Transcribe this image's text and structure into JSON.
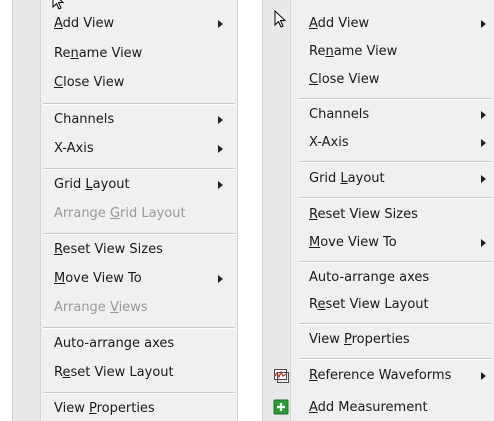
{
  "left_menu": {
    "items": [
      {
        "pre": "",
        "acc": "A",
        "post": "dd View",
        "submenu": true,
        "disabled": false
      },
      {
        "pre": "Re",
        "acc": "n",
        "post": "ame View",
        "submenu": false,
        "disabled": false
      },
      {
        "pre": "",
        "acc": "C",
        "post": "lose View",
        "submenu": false,
        "disabled": false
      },
      {
        "pre": "Channels",
        "acc": "",
        "post": "",
        "submenu": true,
        "disabled": false
      },
      {
        "pre": "X-Axis",
        "acc": "",
        "post": "",
        "submenu": true,
        "disabled": false
      },
      {
        "pre": "Grid ",
        "acc": "L",
        "post": "ayout",
        "submenu": true,
        "disabled": false
      },
      {
        "pre": "Arrange ",
        "acc": "G",
        "post": "rid Layout",
        "submenu": false,
        "disabled": true
      },
      {
        "pre": "",
        "acc": "R",
        "post": "eset View Sizes",
        "submenu": false,
        "disabled": false
      },
      {
        "pre": "",
        "acc": "M",
        "post": "ove View To",
        "submenu": true,
        "disabled": false
      },
      {
        "pre": "Arrange ",
        "acc": "V",
        "post": "iews",
        "submenu": false,
        "disabled": true
      },
      {
        "pre": "Auto-arrange axes",
        "acc": "",
        "post": "",
        "submenu": false,
        "disabled": false
      },
      {
        "pre": "R",
        "acc": "e",
        "post": "set View Layout",
        "submenu": false,
        "disabled": false
      },
      {
        "pre": "View ",
        "acc": "P",
        "post": "roperties",
        "submenu": false,
        "disabled": false
      }
    ]
  },
  "right_menu": {
    "items": [
      {
        "pre": "",
        "acc": "A",
        "post": "dd View",
        "submenu": true,
        "disabled": false,
        "icon": ""
      },
      {
        "pre": "Re",
        "acc": "n",
        "post": "ame View",
        "submenu": false,
        "disabled": false,
        "icon": ""
      },
      {
        "pre": "",
        "acc": "C",
        "post": "lose View",
        "submenu": false,
        "disabled": false,
        "icon": ""
      },
      {
        "pre": "Channels",
        "acc": "",
        "post": "",
        "submenu": true,
        "disabled": false,
        "icon": ""
      },
      {
        "pre": "X-Axis",
        "acc": "",
        "post": "",
        "submenu": true,
        "disabled": false,
        "icon": ""
      },
      {
        "pre": "Grid ",
        "acc": "L",
        "post": "ayout",
        "submenu": true,
        "disabled": false,
        "icon": ""
      },
      {
        "pre": "",
        "acc": "R",
        "post": "eset View Sizes",
        "submenu": false,
        "disabled": false,
        "icon": ""
      },
      {
        "pre": "",
        "acc": "M",
        "post": "ove View To",
        "submenu": true,
        "disabled": false,
        "icon": ""
      },
      {
        "pre": "Auto-arrange axes",
        "acc": "",
        "post": "",
        "submenu": false,
        "disabled": false,
        "icon": ""
      },
      {
        "pre": "R",
        "acc": "e",
        "post": "set View Layout",
        "submenu": false,
        "disabled": false,
        "icon": ""
      },
      {
        "pre": "View ",
        "acc": "P",
        "post": "roperties",
        "submenu": false,
        "disabled": false,
        "icon": ""
      },
      {
        "pre": "",
        "acc": "R",
        "post": "eference Waveforms",
        "submenu": true,
        "disabled": false,
        "icon": "waveform-icon"
      },
      {
        "pre": "",
        "acc": "A",
        "post": "dd Measurement",
        "submenu": false,
        "disabled": false,
        "icon": "add-measurement-icon"
      }
    ]
  },
  "colors": {
    "menu_bg": "#f0f0f0",
    "gutter_bg": "#e9e9e9",
    "disabled_text": "#9a9a9a",
    "add_icon_green": "#2e9b3a"
  }
}
